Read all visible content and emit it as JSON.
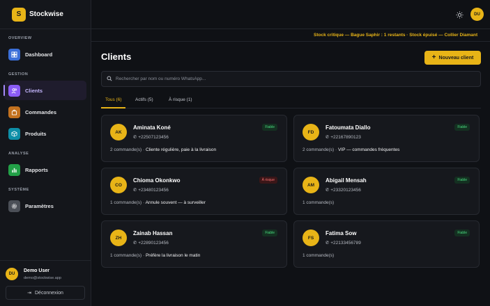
{
  "brand": {
    "name": "Stockwise",
    "logo_letter": "S"
  },
  "sidebar": {
    "sections": {
      "overview": "OVERVIEW",
      "gestion": "GESTION",
      "analyse": "ANALYSE",
      "systeme": "SYSTÈME"
    },
    "items": [
      {
        "label": "Dashboard",
        "icon": "dashboard-icon",
        "color": "#3b6fd8"
      },
      {
        "label": "Clients",
        "icon": "users-icon",
        "color": "#8b5cf6"
      },
      {
        "label": "Commandes",
        "icon": "bag-icon",
        "color": "#c2711f"
      },
      {
        "label": "Produits",
        "icon": "box-icon",
        "color": "#0e8fa8"
      },
      {
        "label": "Rapports",
        "icon": "bar-chart-icon",
        "color": "#22a047"
      },
      {
        "label": "Paramètres",
        "icon": "gear-icon",
        "color": "#4b4f57"
      }
    ]
  },
  "user": {
    "initials": "DU",
    "name": "Demo User",
    "email": "demo@stockwise.app",
    "logout_label": "Déconnexion"
  },
  "ticker": {
    "text": "Stock critique — Bague Saphir : 1 restants · Stock épuisé — Collier Diamant"
  },
  "main": {
    "title": "Clients",
    "new_button": "Nouveau client",
    "search_placeholder": "Rechercher par nom ou numéro WhatsApp...",
    "tabs": [
      "Tous (6)",
      "Actifs (5)",
      "À risque (1)"
    ]
  },
  "clients": [
    {
      "initials": "AK",
      "name": "Aminata Koné",
      "phone": "+22507123456",
      "badge": "Fiable",
      "badge_type": "fiable",
      "orders": "2 commande(s) · ",
      "note": "Cliente régulière, paie à la livraison"
    },
    {
      "initials": "FD",
      "name": "Fatoumata Diallo",
      "phone": "+22167890123",
      "badge": "Fiable",
      "badge_type": "fiable",
      "orders": "2 commande(s) · ",
      "note": "VIP — commandes fréquentes"
    },
    {
      "initials": "CO",
      "name": "Chioma Okonkwo",
      "phone": "+23480123456",
      "badge": "À risque",
      "badge_type": "risque",
      "orders": "1 commande(s) · ",
      "note": "Annule souvent — à surveiller"
    },
    {
      "initials": "AM",
      "name": "Abigail Mensah",
      "phone": "+23320123456",
      "badge": "Fiable",
      "badge_type": "fiable",
      "orders": "1 commande(s)",
      "note": ""
    },
    {
      "initials": "ZH",
      "name": "Zainab Hassan",
      "phone": "+22890123456",
      "badge": "Fiable",
      "badge_type": "fiable",
      "orders": "1 commande(s) · ",
      "note": "Préfère la livraison le matin"
    },
    {
      "initials": "FS",
      "name": "Fatima Sow",
      "phone": "+22133456789",
      "badge": "Fiable",
      "badge_type": "fiable",
      "orders": "1 commande(s)",
      "note": ""
    }
  ]
}
